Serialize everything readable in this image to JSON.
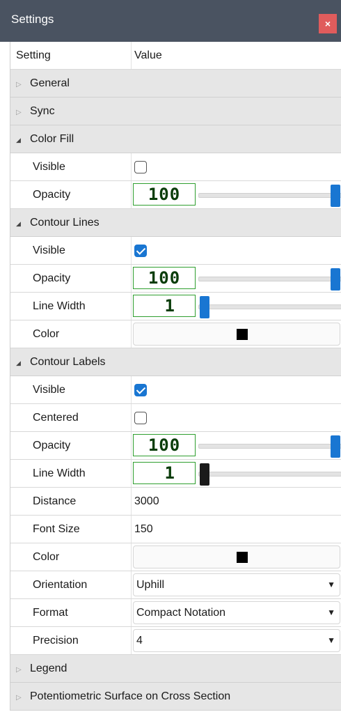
{
  "window": {
    "title": "Settings",
    "close_label": "×"
  },
  "header": {
    "setting": "Setting",
    "value": "Value"
  },
  "groups": {
    "general": "General",
    "sync": "Sync",
    "color_fill": "Color Fill",
    "contour_lines": "Contour Lines",
    "contour_labels": "Contour Labels",
    "legend": "Legend",
    "potentiometric": "Potentiometric Surface on Cross Section"
  },
  "color_fill": {
    "visible_label": "Visible",
    "visible_checked": false,
    "opacity_label": "Opacity",
    "opacity_value": "100"
  },
  "contour_lines": {
    "visible_label": "Visible",
    "visible_checked": true,
    "opacity_label": "Opacity",
    "opacity_value": "100",
    "line_width_label": "Line Width",
    "line_width_value": "1",
    "color_label": "Color",
    "color_hex": "#000000"
  },
  "contour_labels": {
    "visible_label": "Visible",
    "visible_checked": true,
    "centered_label": "Centered",
    "centered_checked": false,
    "opacity_label": "Opacity",
    "opacity_value": "100",
    "line_width_label": "Line Width",
    "line_width_value": "1",
    "distance_label": "Distance",
    "distance_value": "3000",
    "font_size_label": "Font Size",
    "font_size_value": "150",
    "color_label": "Color",
    "color_hex": "#000000",
    "orientation_label": "Orientation",
    "orientation_value": "Uphill",
    "format_label": "Format",
    "format_value": "Compact Notation",
    "precision_label": "Precision",
    "precision_value": "4"
  },
  "colors": {
    "accent": "#1976d2",
    "titlebar": "#4a5361",
    "close": "#e05c5c",
    "lcd_border": "#2e9e2e"
  },
  "icons": {
    "collapsed": "triangle-right-icon",
    "expanded": "triangle-down-icon",
    "dropdown": "caret-down-icon"
  }
}
